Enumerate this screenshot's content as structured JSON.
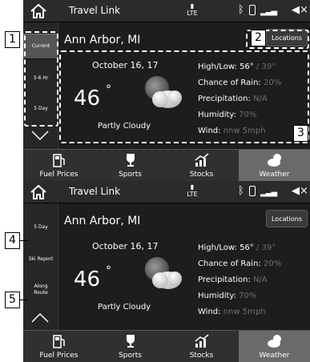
{
  "screens": [
    {
      "app_title": "Travel Link",
      "side_items": [
        "Current",
        "3-6 Hr",
        "5 Day"
      ],
      "city": "Ann Arbor, MI",
      "locations_label": "Locations",
      "date": "October 16, 17",
      "temp": "46",
      "degree": "°",
      "condition": "Partly Cloudy",
      "high_low_label": "High/Low:",
      "high": "56°",
      "low": "/ 39°",
      "rain_label": "Chance of Rain:",
      "rain": "20%",
      "precip_label": "Precipitation:",
      "precip": "N/A",
      "humidity_label": "Humidity:",
      "humidity": "70%",
      "wind_label": "Wind:",
      "wind": "nnw 5mph"
    },
    {
      "app_title": "Travel Link",
      "side_items": [
        "5 Day",
        "Ski Report",
        "Along Route"
      ],
      "city": "Ann Arbor, MI",
      "locations_label": "Locations",
      "date": "October 16, 17",
      "temp": "46",
      "degree": "°",
      "condition": "Partly Cloudy",
      "high_low_label": "High/Low:",
      "high": "56°",
      "low": "/ 39°",
      "rain_label": "Chance of Rain:",
      "rain": "20%",
      "precip_label": "Precipitation:",
      "precip": "N/A",
      "humidity_label": "Humidity:",
      "humidity": "70%",
      "wind_label": "Wind:",
      "wind": "nnw 5mph"
    }
  ],
  "status": {
    "lte": "LTE"
  },
  "tabs": [
    "Fuel Prices",
    "Sports",
    "Stocks",
    "Weather"
  ],
  "callouts": [
    "1",
    "2",
    "3",
    "4",
    "5"
  ],
  "icons": [
    "home-icon",
    "lte-icon",
    "bluetooth-icon",
    "phone-icon",
    "signal-icon",
    "mute-icon",
    "fuel-pump-icon",
    "trophy-icon",
    "chart-icon",
    "cloud-sun-icon"
  ]
}
